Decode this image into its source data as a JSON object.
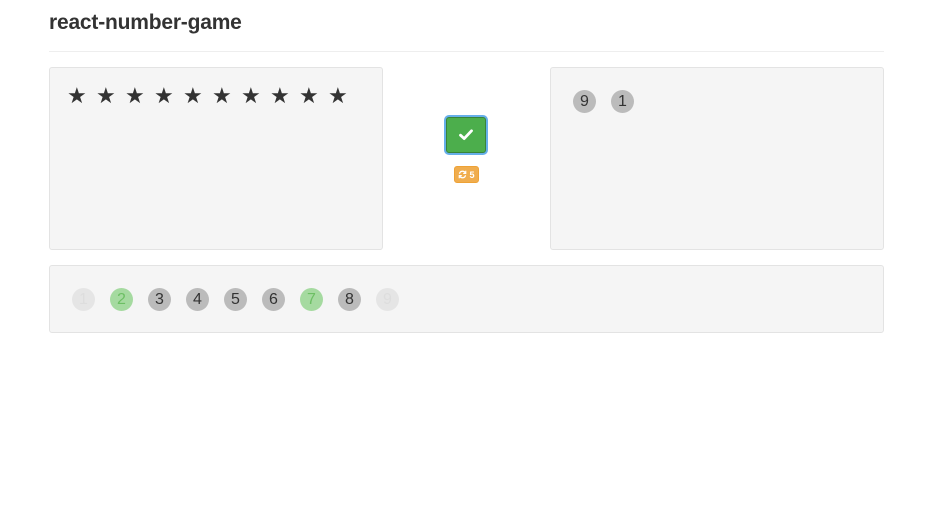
{
  "app": {
    "title": "react-number-game"
  },
  "stars": {
    "count": 10,
    "glyph": "★",
    "icon": "star-icon"
  },
  "controls": {
    "check": {
      "icon": "check-icon",
      "state": "correct",
      "color": "#4cae4c"
    },
    "redraw": {
      "icon": "refresh-icon",
      "count": "5",
      "color": "#f0ad4e"
    }
  },
  "selected_numbers": [
    "9",
    "1"
  ],
  "numbers": [
    {
      "label": "1",
      "state": "used"
    },
    {
      "label": "2",
      "state": "correct"
    },
    {
      "label": "3",
      "state": "default"
    },
    {
      "label": "4",
      "state": "default"
    },
    {
      "label": "5",
      "state": "default"
    },
    {
      "label": "6",
      "state": "default"
    },
    {
      "label": "7",
      "state": "correct"
    },
    {
      "label": "8",
      "state": "default"
    },
    {
      "label": "9",
      "state": "used"
    }
  ],
  "colors": {
    "well_background": "#f5f5f5",
    "number_default": "#bbbbbb",
    "number_used": "#e5e5e5",
    "number_correct": "#a5daa0"
  }
}
